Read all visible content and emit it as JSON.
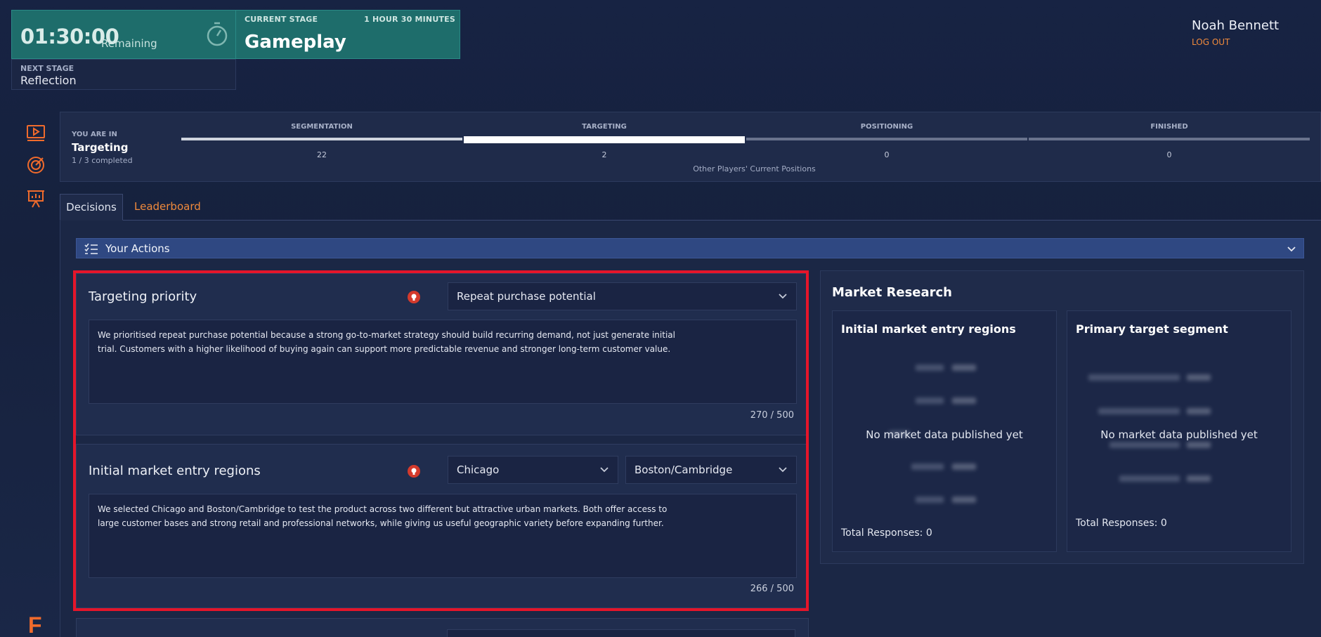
{
  "timer": {
    "value": "01:30:00",
    "remaining_label": "Remaining"
  },
  "current_stage": {
    "label": "CURRENT STAGE",
    "duration": "1 HOUR 30 MINUTES",
    "name": "Gameplay"
  },
  "next_stage": {
    "label": "NEXT STAGE",
    "name": "Reflection"
  },
  "user": {
    "name": "Noah Bennett",
    "logout": "LOG OUT"
  },
  "progress": {
    "you_are_in_label": "YOU ARE IN",
    "current": "Targeting",
    "completed": "1 / 3 completed",
    "stages": [
      {
        "label": "SEGMENTATION",
        "count": "22",
        "state": "done"
      },
      {
        "label": "TARGETING",
        "count": "2",
        "state": "active"
      },
      {
        "label": "POSITIONING",
        "count": "0",
        "state": "todo"
      },
      {
        "label": "FINISHED",
        "count": "0",
        "state": "todo"
      }
    ],
    "others_label": "Other Players' Current Positions"
  },
  "tabs": [
    {
      "label": "Decisions"
    },
    {
      "label": "Leaderboard"
    }
  ],
  "actions": {
    "label": "Your Actions"
  },
  "decisions": [
    {
      "title": "Targeting priority",
      "selects": [
        "Repeat purchase potential"
      ],
      "text": "We prioritised repeat purchase potential because a strong go-to-market strategy should build recurring demand, not just generate initial\ntrial. Customers with a higher likelihood of buying again can support more predictable revenue and stronger long-term customer value.",
      "counter": "270 / 500"
    },
    {
      "title": "Initial market entry regions",
      "selects": [
        "Chicago",
        "Boston/Cambridge"
      ],
      "text": "We selected Chicago and Boston/Cambridge to test the product across two different but attractive urban markets. Both offer access to\nlarge customer bases and strong retail and professional networks, while giving us useful geographic variety before expanding further.",
      "counter": "266 / 500"
    }
  ],
  "market_research": {
    "title": "Market Research",
    "cards": [
      {
        "title": "Initial market entry regions",
        "empty": "No market data published yet",
        "total": "Total Responses: 0"
      },
      {
        "title": "Primary target segment",
        "empty": "No market data published yet",
        "total": "Total Responses: 0"
      }
    ]
  },
  "colors": {
    "accent": "#f08a3c",
    "timer_bg": "#1e6d6b",
    "highlight": "#e5152a",
    "actions_bar": "#2f4882"
  },
  "logo": "F"
}
